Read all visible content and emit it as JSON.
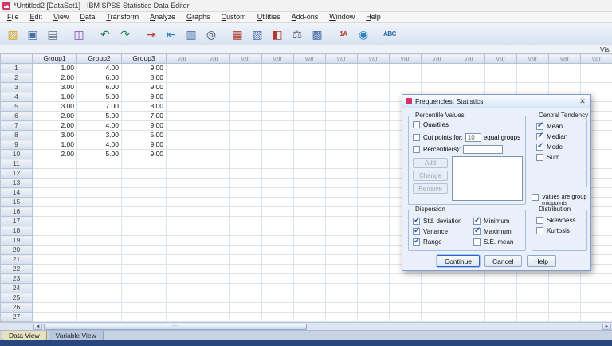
{
  "window": {
    "title": "*Untitled2 [DataSet1] - IBM SPSS Statistics Data Editor"
  },
  "menu": {
    "items": [
      "File",
      "Edit",
      "View",
      "Data",
      "Transform",
      "Analyze",
      "Graphs",
      "Custom",
      "Utilities",
      "Add-ons",
      "Window",
      "Help"
    ]
  },
  "toolbar": {
    "icons": [
      {
        "name": "open-data-icon",
        "glyph": "▨",
        "color": "#d9a520",
        "text": false
      },
      {
        "name": "save-icon",
        "glyph": "▣",
        "color": "#4a6da7",
        "text": false
      },
      {
        "name": "print-icon",
        "glyph": "▤",
        "color": "#5d6d7e",
        "text": false
      },
      {
        "name": "recall-dialogs-icon",
        "glyph": "◫",
        "color": "#8e44ad",
        "text": false
      },
      {
        "name": "undo-icon",
        "glyph": "↶",
        "color": "#1e8449",
        "text": false
      },
      {
        "name": "redo-icon",
        "glyph": "↷",
        "color": "#1e8449",
        "text": false
      },
      {
        "name": "goto-case-icon",
        "glyph": "⇥",
        "color": "#b03a2e",
        "text": false
      },
      {
        "name": "goto-variable-icon",
        "glyph": "⇤",
        "color": "#2e86c1",
        "text": false
      },
      {
        "name": "variables-icon",
        "glyph": "▥",
        "color": "#4a6da7",
        "text": false
      },
      {
        "name": "find-icon",
        "glyph": "◎",
        "color": "#34495e",
        "text": false
      },
      {
        "name": "insert-cases-icon",
        "glyph": "▦",
        "color": "#b03a2e",
        "text": false
      },
      {
        "name": "insert-variable-icon",
        "glyph": "▧",
        "color": "#4a6da7",
        "text": false
      },
      {
        "name": "split-file-icon",
        "glyph": "◧",
        "color": "#b03a2e",
        "text": false
      },
      {
        "name": "weight-cases-icon",
        "glyph": "⚖",
        "color": "#5d6d7e",
        "text": false
      },
      {
        "name": "select-cases-icon",
        "glyph": "▩",
        "color": "#4a6da7",
        "text": false
      },
      {
        "name": "value-labels-icon",
        "glyph": "1A",
        "color": "#b03a2e",
        "text": true
      },
      {
        "name": "use-sets-icon",
        "glyph": "◉",
        "color": "#2e86c1",
        "text": false
      },
      {
        "name": "spell-check-icon",
        "glyph": "ABC",
        "color": "#2e6da4",
        "text": true
      }
    ]
  },
  "info_bar": {
    "visible_text": "Visi"
  },
  "grid": {
    "data_columns": [
      "Group1",
      "Group2",
      "Group3"
    ],
    "var_column_label": "var",
    "var_column_count": 14,
    "row_count": 27,
    "rows": [
      [
        "1.00",
        "4.00",
        "9.00"
      ],
      [
        "2.00",
        "6.00",
        "8.00"
      ],
      [
        "3.00",
        "6.00",
        "9.00"
      ],
      [
        "1.00",
        "5.00",
        "9.00"
      ],
      [
        "3.00",
        "7.00",
        "8.00"
      ],
      [
        "2.00",
        "5.00",
        "7.00"
      ],
      [
        "2.00",
        "4.00",
        "9.00"
      ],
      [
        "3.00",
        "3.00",
        "5.00"
      ],
      [
        "1.00",
        "4.00",
        "9.00"
      ],
      [
        "2.00",
        "5.00",
        "9.00"
      ]
    ]
  },
  "dialog": {
    "title": "Frequencies: Statistics",
    "close_glyph": "✕",
    "percentile_values": {
      "title": "Percentile Values",
      "quartiles": {
        "label": "Quartiles",
        "checked": false
      },
      "cut_points": {
        "label": "Cut points for:",
        "value": "10",
        "suffix": "equal groups",
        "checked": false
      },
      "percentiles": {
        "label": "Percentile(s):",
        "value": "",
        "checked": false
      },
      "add_label": "Add",
      "change_label": "Change",
      "remove_label": "Remove"
    },
    "central_tendency": {
      "title": "Central Tendency",
      "options": [
        {
          "label": "Mean",
          "checked": true
        },
        {
          "label": "Median",
          "checked": true
        },
        {
          "label": "Mode",
          "checked": true
        },
        {
          "label": "Sum",
          "checked": false
        }
      ]
    },
    "group_midpoints": {
      "label": "Values are group midpoints",
      "checked": false
    },
    "dispersion": {
      "title": "Dispersion",
      "options": [
        {
          "label": "Std. deviation",
          "checked": true
        },
        {
          "label": "Variance",
          "checked": true
        },
        {
          "label": "Range",
          "checked": true
        },
        {
          "label": "Minimum",
          "checked": true
        },
        {
          "label": "Maximum",
          "checked": true
        },
        {
          "label": "S.E. mean",
          "checked": false
        }
      ]
    },
    "distribution": {
      "title": "Distribution",
      "options": [
        {
          "label": "Skewness",
          "checked": false
        },
        {
          "label": "Kurtosis",
          "checked": false
        }
      ]
    },
    "buttons": [
      "Continue",
      "Cancel",
      "Help"
    ]
  },
  "tabs": {
    "items": [
      {
        "label": "Data View",
        "active": true
      },
      {
        "label": "Variable View",
        "active": false
      }
    ]
  }
}
